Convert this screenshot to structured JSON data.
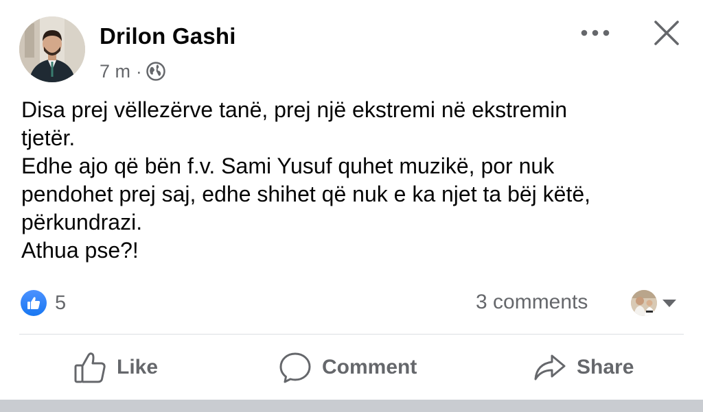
{
  "post": {
    "author": {
      "name": "Drilon Gashi",
      "avatar": "profile-photo"
    },
    "meta": {
      "time": "7 m",
      "separator": "·",
      "audience_icon": "globe-icon"
    },
    "header_actions": {
      "more_icon": "more-dots-icon",
      "close_icon": "close-icon"
    },
    "text_lines": [
      "Disa prej vëllezërve tanë, prej një ekstremi në ekstremin",
      "tjetër.",
      "Edhe ajo që bën f.v. Sami Yusuf quhet muzikë, por nuk",
      "pendohet prej saj, edhe shihet që nuk e ka njet ta bëj këtë,",
      "përkundrazi.",
      "Athua pse?!"
    ],
    "reactions": {
      "icon": "thumbs-up-icon",
      "count": "5"
    },
    "comments": {
      "label": "3 comments",
      "commenter_avatar": "commenter-photo",
      "caret_icon": "caret-down-icon"
    },
    "actions": {
      "like_label": "Like",
      "comment_label": "Comment",
      "share_label": "Share"
    },
    "colors": {
      "primary_text": "#050505",
      "secondary_text": "#65676b",
      "like_blue": "#1877f2",
      "divider": "#dcdee3"
    }
  }
}
